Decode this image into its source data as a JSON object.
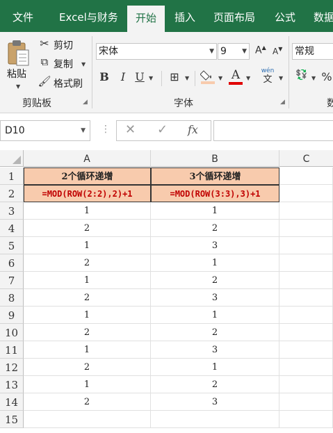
{
  "ribbon_tabs": [
    "文件",
    "Excel与财务",
    "开始",
    "插入",
    "页面布局",
    "公式",
    "数据"
  ],
  "active_tab": "开始",
  "clipboard": {
    "paste_label": "粘贴",
    "cut_label": "剪切",
    "copy_label": "复制",
    "format_painter_label": "格式刷",
    "group_label": "剪贴板"
  },
  "font": {
    "font_name": "宋体",
    "font_size": "9",
    "bold": "B",
    "italic": "I",
    "underline": "U",
    "font_color_glyph": "A",
    "grow_glyph": "A",
    "shrink_glyph": "A",
    "phonetic_top": "wén",
    "phonetic_bottom": "文",
    "group_label": "字体"
  },
  "number": {
    "format_value": "常规",
    "percent": "%",
    "group_label_partial": "数"
  },
  "formula_bar": {
    "name_box": "D10",
    "fx": "fx",
    "content": ""
  },
  "sheet": {
    "columns": [
      "A",
      "B",
      "C"
    ],
    "header_row": [
      "2个循环递增",
      "3个循环递增"
    ],
    "formula_row": [
      "=MOD(ROW(2:2),2)+1",
      "=MOD(ROW(3:3),3)+1"
    ],
    "row_numbers": [
      "1",
      "2",
      "3",
      "4",
      "5",
      "6",
      "7",
      "8",
      "9",
      "10",
      "11",
      "12",
      "13",
      "14",
      "15"
    ],
    "col_a_values": [
      "1",
      "2",
      "1",
      "2",
      "1",
      "2",
      "1",
      "2",
      "1",
      "2",
      "1",
      "2"
    ],
    "col_b_values": [
      "1",
      "2",
      "3",
      "1",
      "2",
      "3",
      "1",
      "2",
      "3",
      "1",
      "2",
      "3"
    ]
  },
  "colors": {
    "excel_green": "#217346",
    "header_fill": "#f8cbad",
    "formula_text": "#c00000"
  }
}
